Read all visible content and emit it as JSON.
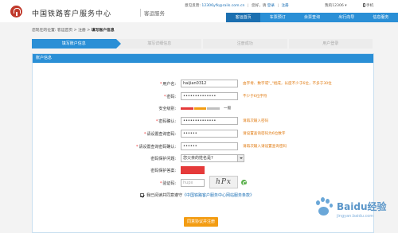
{
  "header": {
    "site_title": "中国铁路客户服务中心",
    "site_sub": "客运服务",
    "feedback_label": "意见反馈:",
    "feedback_email": "12306yfk@rails.com.cn",
    "greeting": "您好，请",
    "login": "登录",
    "register": "注册",
    "my_account": "我的12306",
    "mobile": "手机"
  },
  "nav": {
    "items": [
      {
        "label": "客运首页"
      },
      {
        "label": "车票预订"
      },
      {
        "label": "余票查询"
      },
      {
        "label": "出行向导"
      },
      {
        "label": "信息服务"
      }
    ]
  },
  "breadcrumb": {
    "prefix": "您现在的位置: 客运首页 > 注册 > ",
    "current": "填写账户信息"
  },
  "steps": [
    "填写账户信息",
    "填写详细信息",
    "注册成功",
    "用户登录"
  ],
  "panel": {
    "title": "账户信息"
  },
  "form": {
    "username": {
      "label": "用户名:",
      "value": "haijian0312",
      "hint": "由字母、数字或\"_\"组成，长度不少于6位，不多于30位"
    },
    "password": {
      "label": "密码:",
      "value": "••••••••••••••",
      "hint": "不少于6位字符"
    },
    "security": {
      "label": "安全级别:",
      "level": "一般",
      "colors": [
        "#e53a3a",
        "#f39c12",
        "#bfbfbf"
      ]
    },
    "password_confirm": {
      "label": "密码确认:",
      "value": "••••••••••••••",
      "hint": "请再次输入密码"
    },
    "query_password": {
      "label": "请设置查询密码:",
      "value": "••••••",
      "hint": "请设置查询密码为6位数字"
    },
    "query_password_confirm": {
      "label": "请设置查询密码确认:",
      "value": "••••••",
      "hint": "请再次输入请设置查询密码"
    },
    "security_question": {
      "label": "密码保护问题:",
      "value": "您父亲的姓名是?"
    },
    "security_answer": {
      "label": "密码保护答案:"
    },
    "captcha": {
      "label": "验证码:",
      "placeholder": "hupx",
      "image_text": "hPx"
    },
    "agree": {
      "text": "我已阅读并同意遵守",
      "link": "《中国铁路客户服务中心网站服务条款》"
    },
    "submit_label": "同意协议并注册"
  },
  "watermark": {
    "text": "Baidu经验",
    "url": "jingyan.baidu.com"
  }
}
